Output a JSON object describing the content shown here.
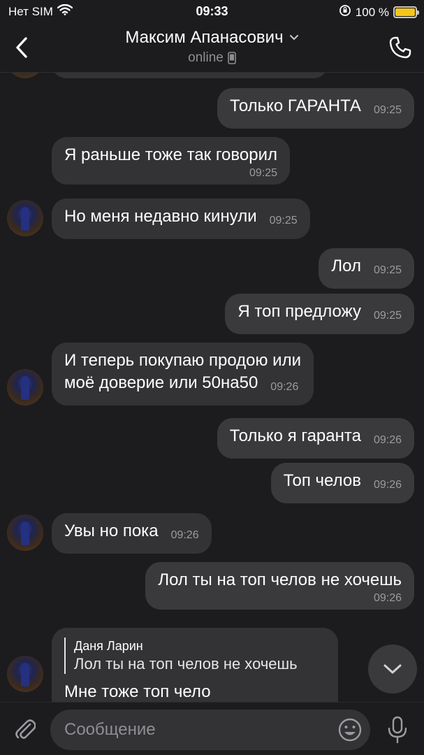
{
  "status_bar": {
    "carrier": "Нет SIM",
    "time": "09:33",
    "battery": "100 %",
    "battery_level": 1.0
  },
  "header": {
    "title": "Максим Апанасович",
    "status": "online",
    "icons": {
      "back": "chevron-left-icon",
      "expand": "chevron-down-icon",
      "device": "mobile-phone-icon",
      "call": "phone-icon"
    }
  },
  "messages": [
    {
      "side": "out",
      "text": "Только ГАРАНТА",
      "time": "09:25"
    },
    {
      "side": "in",
      "text": "Я раньше тоже так говорил",
      "time": "09:25"
    },
    {
      "side": "in",
      "text": "Но меня недавно кинули",
      "time": "09:25"
    },
    {
      "side": "out",
      "text": "Лол",
      "time": "09:25"
    },
    {
      "side": "out",
      "text": "Я топ предложу",
      "time": "09:25"
    },
    {
      "side": "in",
      "text_line1": "И теперь покупаю продою или",
      "text_line2": "моё доверие или 50на50",
      "time": "09:26"
    },
    {
      "side": "out",
      "text": "Только я гаранта",
      "time": "09:26"
    },
    {
      "side": "out",
      "text": "Топ челов",
      "time": "09:26"
    },
    {
      "side": "in",
      "text": "Увы но пока",
      "time": "09:26"
    },
    {
      "side": "out",
      "text": "Лол ты на топ челов не хочешь",
      "time": "09:26"
    },
    {
      "side": "in",
      "reply_name": "Даня Ларин",
      "reply_text": "Лол ты на топ челов не хочешь",
      "text": "Мне тоже топ чело"
    }
  ],
  "input": {
    "placeholder": "Сообщение",
    "icons": {
      "attach": "paperclip-icon",
      "emoji": "emoji-icon",
      "mic": "microphone-icon",
      "scroll": "chevron-down-icon"
    }
  }
}
